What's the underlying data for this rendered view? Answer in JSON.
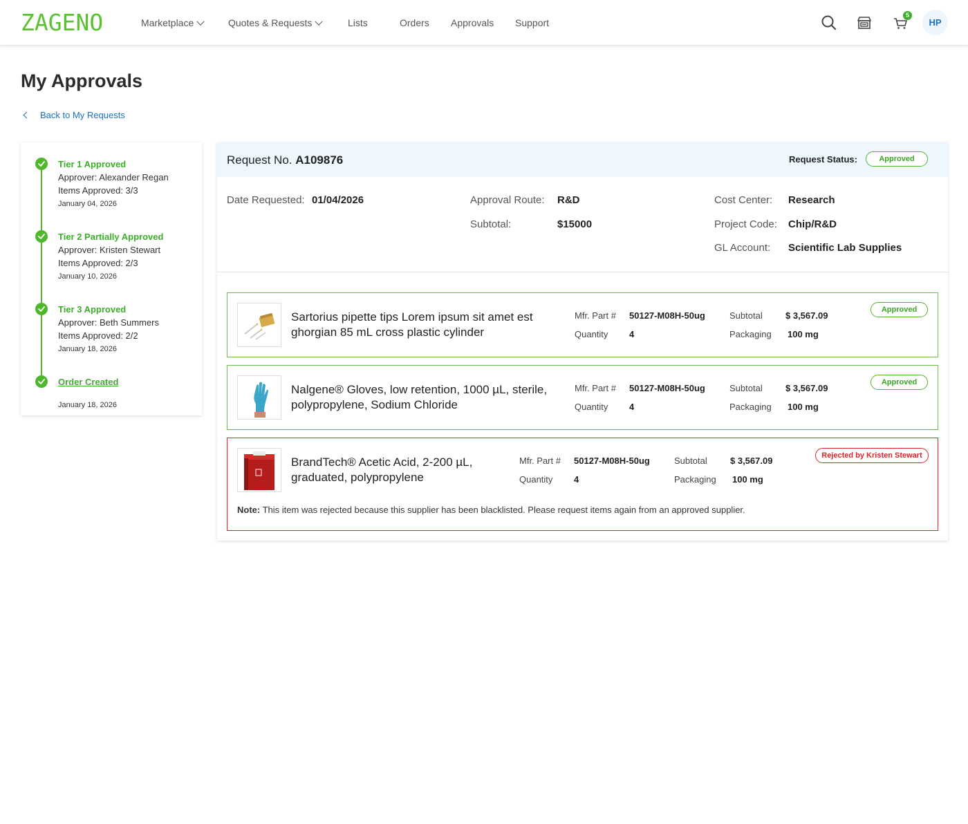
{
  "header": {
    "logo": "ZAGENO",
    "nav": [
      {
        "label": "Marketplace",
        "dropdown": true
      },
      {
        "label": "Quotes & Requests",
        "dropdown": true
      },
      {
        "label": "Lists",
        "dropdown": false
      },
      {
        "label": "Orders",
        "dropdown": false
      },
      {
        "label": "Approvals",
        "dropdown": false
      },
      {
        "label": "Support",
        "dropdown": false
      }
    ],
    "icons": [
      "search-icon",
      "store-icon",
      "cart-icon"
    ],
    "cart_count": "5",
    "avatar_initials": "HP"
  },
  "page": {
    "title": "My Approvals",
    "back_link": "Back to My Requests"
  },
  "timeline": [
    {
      "title": "Tier 1 Approved",
      "approver": "Approver: Alexander Regan",
      "items": "Items Approved: 3/3",
      "date": "January 04, 2026"
    },
    {
      "title": "Tier 2 Partially Approved",
      "approver": "Approver: Kristen Stewart",
      "items": "Items Approved: 2/3",
      "date": "January 10, 2026"
    },
    {
      "title": "Tier 3 Approved",
      "approver": "Approver: Beth Summers",
      "items": "Items Approved: 2/2",
      "date": "January 18, 2026"
    },
    {
      "title": "Order Created",
      "date": "January 18, 2026"
    }
  ],
  "request": {
    "number_label": "Request No.",
    "number": "A109876",
    "status_label": "Request Status:",
    "status": "Approved",
    "date_label": "Date Requested:",
    "date": "01/04/2026",
    "route_label": "Approval Route:",
    "route": "R&D",
    "subtotal_label": "Subtotal:",
    "subtotal": "$15000",
    "cost_center_label": "Cost Center:",
    "cost_center": "Research",
    "project_code_label": "Project Code:",
    "project_code": "Chip/R&D",
    "gl_account_label": "GL Account:",
    "gl_account": "Scientific Lab Supplies"
  },
  "field_labels": {
    "mfr": "Mfr. Part #",
    "quantity": "Quantity",
    "subtotal": "Subtotal",
    "packaging": "Packaging"
  },
  "items": [
    {
      "name": "Sartorius pipette tips Lorem ipsum sit amet est ghorgian 85 mL cross plastic cylinder",
      "mfr": "50127-M08H-50ug",
      "quantity": "4",
      "subtotal": "$ 3,567.09",
      "packaging": "100 mg",
      "status": "Approved"
    },
    {
      "name": "Nalgene® Gloves, low retention, 1000 µL, sterile, polypropylene, Sodium Chloride",
      "mfr": "50127-M08H-50ug",
      "quantity": "4",
      "subtotal": "$ 3,567.09",
      "packaging": "100 mg",
      "status": "Approved"
    },
    {
      "name": "BrandTech®  Acetic Acid, 2-200 µL, graduated, polypropylene",
      "mfr": "50127-M08H-50ug",
      "quantity": "4",
      "subtotal": "$ 3,567.09",
      "packaging": "100 mg",
      "status": "Rejected by Kristen Stewart",
      "note_label": "Note:",
      "note": "This item was rejected because this supplier has been blacklisted. Please request items again from an approved supplier."
    }
  ],
  "colors": {
    "brand_green": "#5ac230",
    "approved_green": "#4fb72c",
    "rejected_red": "#d9262d",
    "link_blue": "#1a6fbf",
    "panel_head_bg": "#eef7fd"
  }
}
